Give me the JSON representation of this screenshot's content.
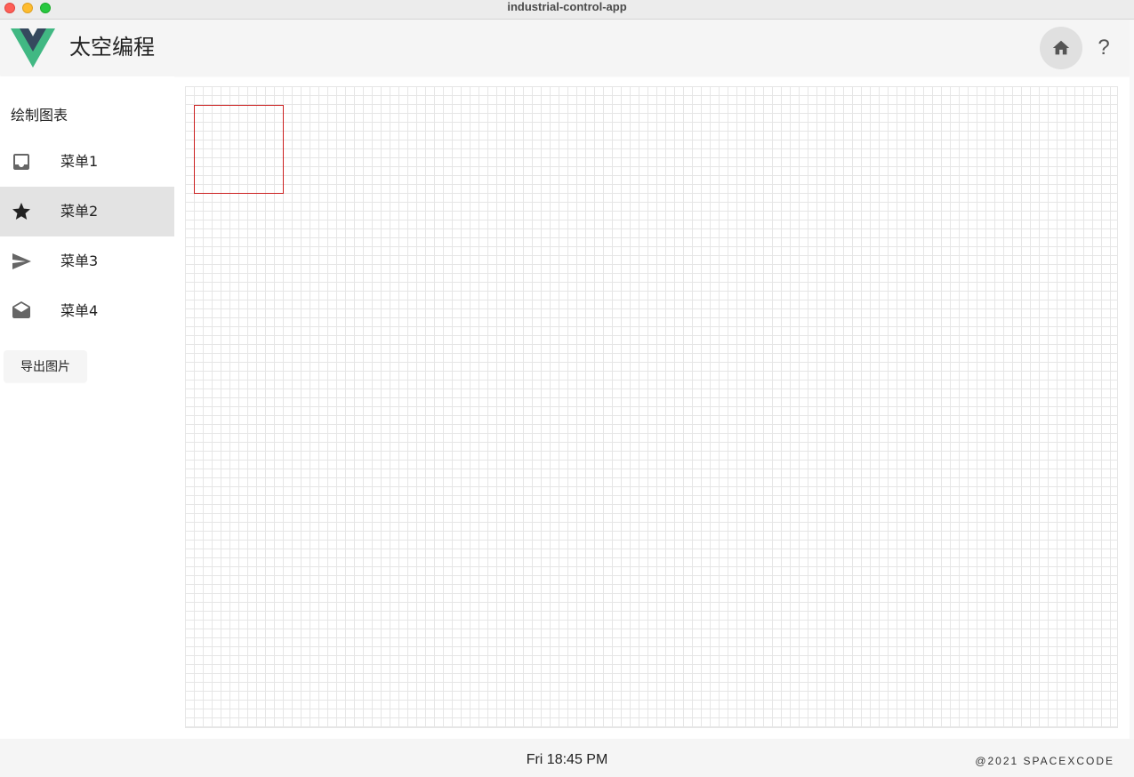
{
  "window": {
    "title": "industrial-control-app"
  },
  "header": {
    "app_title": "太空编程",
    "home_icon": "home-icon",
    "help_label": "?"
  },
  "sidebar": {
    "heading": "绘制图表",
    "items": [
      {
        "label": "菜单1",
        "icon": "inbox-icon",
        "active": false
      },
      {
        "label": "菜单2",
        "icon": "star-icon",
        "active": true
      },
      {
        "label": "菜单3",
        "icon": "send-icon",
        "active": false
      },
      {
        "label": "菜单4",
        "icon": "mail-open-icon",
        "active": false
      }
    ],
    "export_label": "导出图片"
  },
  "footer": {
    "time": "Fri 18:45 PM",
    "copyright": "@2021 SPACEXCODE"
  },
  "colors": {
    "logo_green": "#41b883",
    "logo_dark": "#35495e",
    "rect_stroke": "#cc2222",
    "active_bg": "#e3e3e3"
  }
}
